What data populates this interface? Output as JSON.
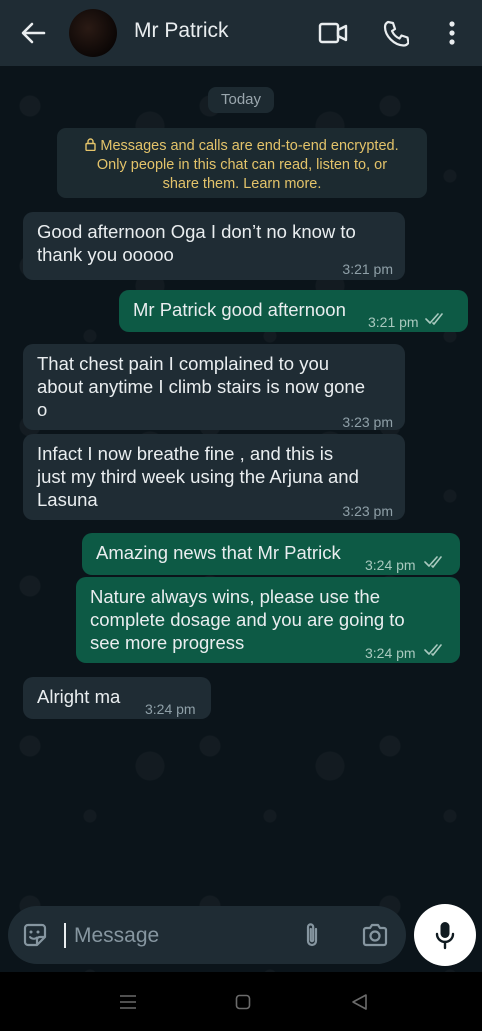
{
  "header": {
    "contact_name": "Mr Patrick",
    "icons": [
      "back-arrow-icon",
      "video-call-icon",
      "phone-call-icon",
      "more-options-icon"
    ]
  },
  "chat": {
    "date_chip": "Today",
    "encryption_notice": {
      "line1": "Messages and calls are end-to-end encrypted.",
      "line2": "Only people in this chat can read, listen to, or",
      "line3": "share them. Learn more."
    },
    "messages": [
      {
        "direction": "incoming",
        "lines": [
          "Good afternoon Oga I don’t no know to",
          "thank you ooooo"
        ],
        "time": "3:21 pm"
      },
      {
        "direction": "outgoing",
        "lines": [
          "Mr Patrick good afternoon"
        ],
        "time": "3:21 pm",
        "status": "read"
      },
      {
        "direction": "incoming",
        "lines": [
          "That chest pain I complained to you",
          "about anytime I climb stairs is now gone",
          "o"
        ],
        "time": "3:23 pm"
      },
      {
        "direction": "incoming",
        "lines": [
          "Infact I now breathe fine , and this is",
          "just my third week using the Arjuna and",
          "Lasuna"
        ],
        "time": "3:23 pm"
      },
      {
        "direction": "outgoing",
        "lines": [
          "Amazing news that Mr Patrick"
        ],
        "time": "3:24 pm",
        "status": "read"
      },
      {
        "direction": "outgoing",
        "lines": [
          "Nature always wins, please use the",
          "complete dosage and you are going to",
          "see more progress"
        ],
        "time": "3:24 pm",
        "status": "read"
      },
      {
        "direction": "incoming",
        "lines": [
          "Alright ma"
        ],
        "time": "3:24 pm"
      }
    ]
  },
  "composer": {
    "placeholder": "Message",
    "icons": [
      "emoji-sticker-icon",
      "attach-icon",
      "camera-icon",
      "microphone-icon"
    ]
  },
  "colors": {
    "header_bg": "#1f2c34",
    "chat_bg": "#0b141a",
    "incoming_bubble": "#1f2c34",
    "outgoing_bubble": "#0d5a45",
    "encryption_text": "#e3c36a"
  }
}
